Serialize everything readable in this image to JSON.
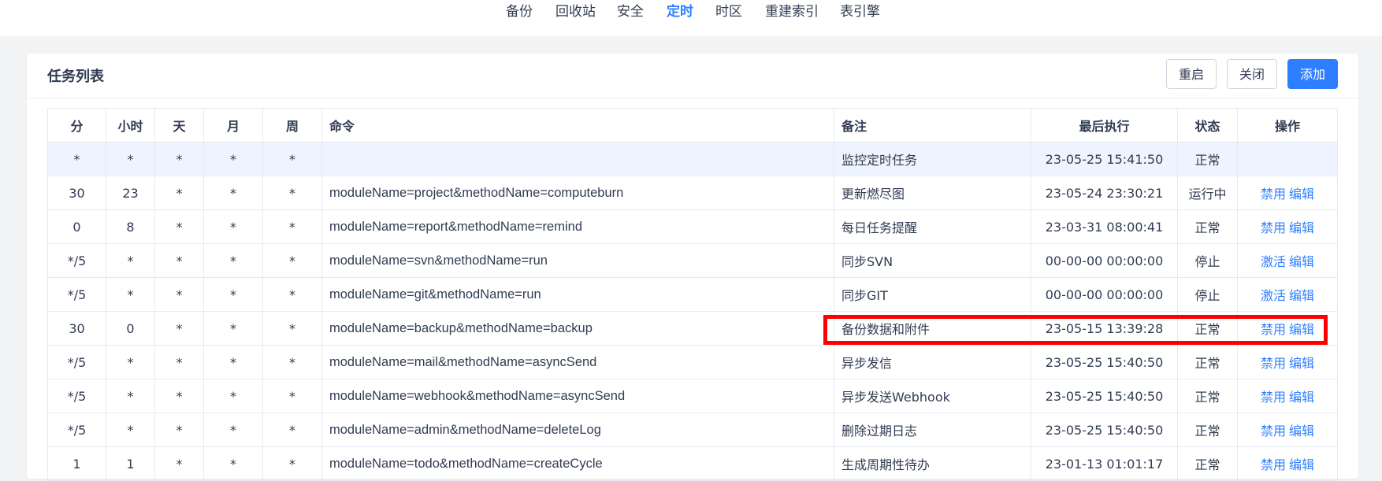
{
  "topnav": {
    "items": [
      {
        "label": "备份",
        "active": false
      },
      {
        "label": "回收站",
        "active": false
      },
      {
        "label": "安全",
        "active": false
      },
      {
        "label": "定时",
        "active": true
      },
      {
        "label": "时区",
        "active": false
      },
      {
        "label": "重建索引",
        "active": false
      },
      {
        "label": "表引擎",
        "active": false
      }
    ],
    "accent_color": "#2e7fff"
  },
  "panel": {
    "title": "任务列表",
    "buttons": {
      "restart": "重启",
      "close": "关闭",
      "add": "添加"
    }
  },
  "table": {
    "headers": [
      "分",
      "小时",
      "天",
      "月",
      "周",
      "命令",
      "备注",
      "最后执行",
      "状态",
      "操作"
    ],
    "rows": [
      {
        "m": "*",
        "h": "*",
        "dom": "*",
        "mon": "*",
        "dow": "*",
        "command": "",
        "remark": "监控定时任务",
        "last_run": "23-05-25 15:41:50",
        "status": "正常",
        "action1": "",
        "action2": "",
        "highlighted": true
      },
      {
        "m": "30",
        "h": "23",
        "dom": "*",
        "mon": "*",
        "dow": "*",
        "command": "moduleName=project&methodName=computeburn",
        "remark": "更新燃尽图",
        "last_run": "23-05-24 23:30:21",
        "status": "运行中",
        "action1": "禁用",
        "action2": "编辑"
      },
      {
        "m": "0",
        "h": "8",
        "dom": "*",
        "mon": "*",
        "dow": "*",
        "command": "moduleName=report&methodName=remind",
        "remark": "每日任务提醒",
        "last_run": "23-03-31 08:00:41",
        "status": "正常",
        "action1": "禁用",
        "action2": "编辑"
      },
      {
        "m": "*/5",
        "h": "*",
        "dom": "*",
        "mon": "*",
        "dow": "*",
        "command": "moduleName=svn&methodName=run",
        "remark": "同步SVN",
        "last_run": "00-00-00 00:00:00",
        "status": "停止",
        "action1": "激活",
        "action2": "编辑"
      },
      {
        "m": "*/5",
        "h": "*",
        "dom": "*",
        "mon": "*",
        "dow": "*",
        "command": "moduleName=git&methodName=run",
        "remark": "同步GIT",
        "last_run": "00-00-00 00:00:00",
        "status": "停止",
        "action1": "激活",
        "action2": "编辑"
      },
      {
        "m": "30",
        "h": "0",
        "dom": "*",
        "mon": "*",
        "dow": "*",
        "command": "moduleName=backup&methodName=backup",
        "remark": "备份数据和附件",
        "last_run": "23-05-15 13:39:28",
        "status": "正常",
        "action1": "禁用",
        "action2": "编辑"
      },
      {
        "m": "*/5",
        "h": "*",
        "dom": "*",
        "mon": "*",
        "dow": "*",
        "command": "moduleName=mail&methodName=asyncSend",
        "remark": "异步发信",
        "last_run": "23-05-25 15:40:50",
        "status": "正常",
        "action1": "禁用",
        "action2": "编辑"
      },
      {
        "m": "*/5",
        "h": "*",
        "dom": "*",
        "mon": "*",
        "dow": "*",
        "command": "moduleName=webhook&methodName=asyncSend",
        "remark": "异步发送Webhook",
        "last_run": "23-05-25 15:40:50",
        "status": "正常",
        "action1": "禁用",
        "action2": "编辑"
      },
      {
        "m": "*/5",
        "h": "*",
        "dom": "*",
        "mon": "*",
        "dow": "*",
        "command": "moduleName=admin&methodName=deleteLog",
        "remark": "删除过期日志",
        "last_run": "23-05-25 15:40:50",
        "status": "正常",
        "action1": "禁用",
        "action2": "编辑"
      },
      {
        "m": "1",
        "h": "1",
        "dom": "*",
        "mon": "*",
        "dow": "*",
        "command": "moduleName=todo&methodName=createCycle",
        "remark": "生成周期性待办",
        "last_run": "23-01-13 01:01:17",
        "status": "正常",
        "action1": "禁用",
        "action2": "编辑"
      }
    ]
  },
  "annotation": {
    "highlight_color": "#ff0000"
  }
}
